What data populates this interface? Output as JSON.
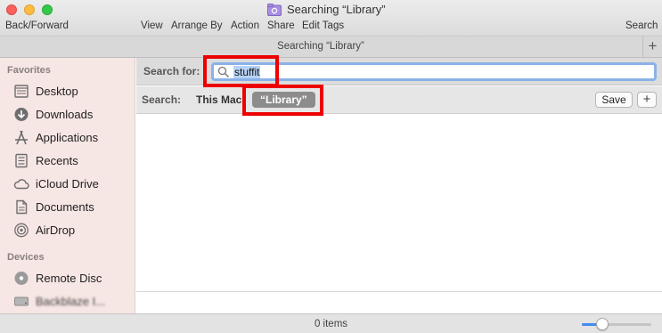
{
  "window": {
    "title": "Searching “Library”",
    "tab_title": "Searching “Library”",
    "tab_add_label": "+"
  },
  "toolbar": {
    "back_forward": "Back/Forward",
    "view": "View",
    "arrange_by": "Arrange By",
    "action": "Action",
    "share": "Share",
    "edit_tags": "Edit Tags",
    "search": "Search"
  },
  "sidebar": {
    "favorites_header": "Favorites",
    "favorites": [
      {
        "label": "Desktop",
        "icon": "desktop-icon"
      },
      {
        "label": "Downloads",
        "icon": "downloads-icon"
      },
      {
        "label": "Applications",
        "icon": "applications-icon"
      },
      {
        "label": "Recents",
        "icon": "recents-icon"
      },
      {
        "label": "iCloud Drive",
        "icon": "cloud-icon"
      },
      {
        "label": "Documents",
        "icon": "documents-icon"
      },
      {
        "label": "AirDrop",
        "icon": "airdrop-icon"
      }
    ],
    "devices_header": "Devices",
    "devices": [
      {
        "label": "Remote Disc",
        "icon": "disc-icon"
      },
      {
        "label": "Backblaze I...",
        "icon": "drive-icon"
      }
    ]
  },
  "search": {
    "label": "Search for:",
    "value": "stuffit",
    "scope_label": "Search:",
    "scope_this_mac": "This Mac",
    "scope_library": "“Library”",
    "save_label": "Save",
    "add_label": "+"
  },
  "status": {
    "items_text": "0 items",
    "icon_size_fraction": 0.25
  },
  "colors": {
    "sidebar_bg": "#f6e6e4",
    "highlight": "#ee0000",
    "search_focus": "#8bb2e8",
    "selection": "#b6d2f5",
    "slider_accent": "#3f8cf2"
  }
}
